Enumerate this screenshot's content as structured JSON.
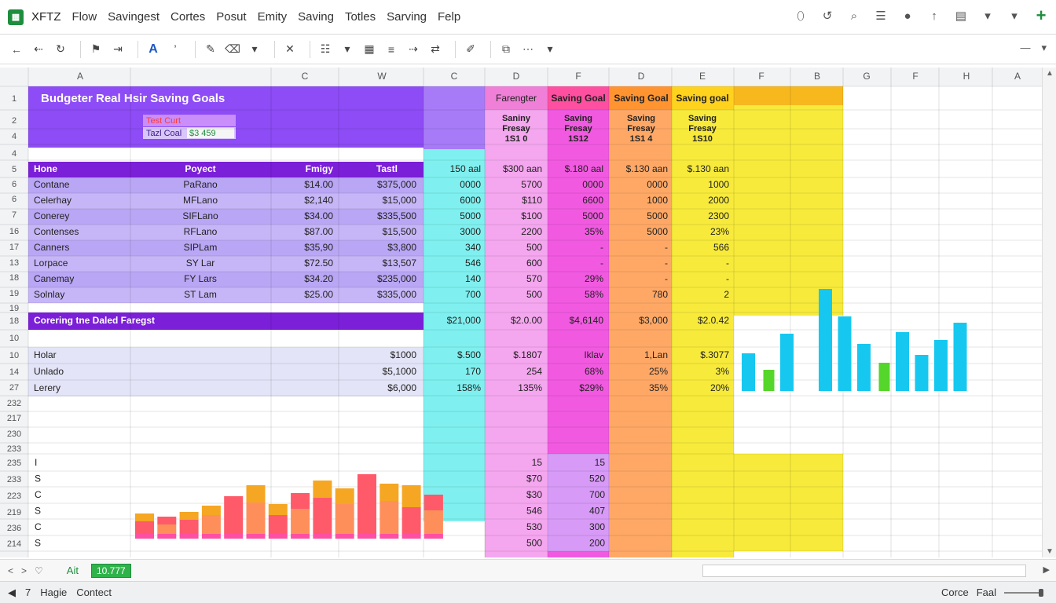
{
  "app": {
    "logo_glyph": "▦",
    "title": "XFTZ"
  },
  "menu": [
    "Flow",
    "Savingest",
    "Cortes",
    "Posut",
    "Emity",
    "Saving",
    "Totles",
    "Sarving",
    "Felp"
  ],
  "top_icons": [
    "lock-icon",
    "history-icon",
    "search-icon",
    "list-icon",
    "user-icon",
    "upload-icon",
    "calendar-icon",
    "chevron-down-icon",
    "chevron-down-icon",
    "add-icon"
  ],
  "toolbar": {
    "undo": "←",
    "redo": "⇠",
    "refresh": "↻",
    "font_btn": "A",
    "font_drop": "ʼ",
    "close": "✕"
  },
  "column_headers": [
    "A",
    "C",
    "W",
    "C",
    "D",
    "F",
    "D",
    "E",
    "F",
    "B",
    "G",
    "F",
    "H",
    "A"
  ],
  "row_headers": [
    "1",
    "2",
    "4",
    "4",
    "5",
    "6",
    "6",
    "7",
    "16",
    "17",
    "13",
    "18",
    "19",
    "19",
    "18",
    "10",
    "10",
    "14",
    "27",
    "232",
    "217",
    "230",
    "233",
    "235",
    "233",
    "223",
    "219",
    "236",
    "214"
  ],
  "sheet": {
    "title": "Budgeter Real Hsir Saving Goals",
    "mini_label_1": "Test Curt",
    "mini_label_2": "Tazl Coal",
    "mini_value": "$3 459",
    "header_cols": [
      "Farengter",
      "Saving Goal",
      "Saving Goal",
      "Saving goal"
    ],
    "sub_headers": [
      [
        "Saniny",
        "Fresay",
        "1S1 0"
      ],
      [
        "Saving",
        "Fresay",
        "1S12"
      ],
      [
        "Saving",
        "Fresay",
        "1S1 4"
      ],
      [
        "Saving",
        "Fresay",
        "1S10"
      ]
    ],
    "table_header": [
      "Hone",
      "Poyect",
      "Fmigy",
      "Tastl",
      "150 aal",
      "$300 aan",
      "$.180 aal",
      "$.130 aan",
      "$.130 aan"
    ],
    "rows": [
      [
        "Contane",
        "PaRano",
        "$14.00",
        "$375,000",
        "0000",
        "5700",
        "0000",
        "0000",
        "1000"
      ],
      [
        "Celerhay",
        "MFLano",
        "$2,140",
        "$15,000",
        "6000",
        "$110",
        "6600",
        "1000",
        "2000"
      ],
      [
        "Conerey",
        "SIFLano",
        "$34.00",
        "$335,500",
        "5000",
        "$100",
        "5000",
        "5000",
        "2300"
      ],
      [
        "Contenses",
        "RFLano",
        "$87.00",
        "$15,500",
        "3000",
        "2200",
        "35%",
        "5000",
        "23%"
      ],
      [
        "Canners",
        "SIPLam",
        "$35,90",
        "$3,800",
        "340",
        "500",
        "-",
        "-",
        "566"
      ],
      [
        "Lorpace",
        "SY Lar",
        "$72.50",
        "$13,507",
        "546",
        "600",
        "-",
        "-",
        "-"
      ],
      [
        "Canemay",
        "FY Lars",
        "$34.20",
        "$235,000",
        "140",
        "570",
        "29%",
        "-",
        "-"
      ],
      [
        "Solnlay",
        "ST Lam",
        "$25.00",
        "$335,000",
        "700",
        "500",
        "58%",
        "780",
        "2"
      ]
    ],
    "section_title": "Corering tne Daled Faregst",
    "section_totals": [
      "$21,000",
      "$2.0.00",
      "$4,6140",
      "$3,000",
      "$2.0.42"
    ],
    "rows2": [
      [
        "Holar",
        "$1000",
        "$.500",
        "$.1807",
        "Iklav",
        "1,Lan",
        "$.3077"
      ],
      [
        "Unlado",
        "$5,1000",
        "170",
        "254",
        "68%",
        "25%",
        "3%"
      ],
      [
        "Lerery",
        "$6,000",
        "158%",
        "135%",
        "$29%",
        "35%",
        "20%"
      ]
    ],
    "lower_labels": [
      "I",
      "S",
      "C",
      "S",
      "C",
      "S"
    ],
    "lower_pink": [
      "15",
      "$70",
      "$30",
      "546",
      "530",
      "500"
    ],
    "lower_purple": [
      "15",
      "520",
      "700",
      "407",
      "300",
      "200"
    ]
  },
  "chart_right": {
    "type": "bar",
    "series": [
      {
        "values": [
          48,
          0,
          73,
          0,
          130,
          95,
          60,
          0,
          75,
          46,
          65,
          87
        ]
      },
      {
        "values": [
          0,
          27,
          0,
          0,
          0,
          0,
          0,
          36,
          0,
          0,
          0,
          0
        ]
      }
    ],
    "colors": [
      "#16c8f0",
      "#55d62a"
    ]
  },
  "chart_bottom": {
    "type": "bar",
    "values_top": [
      32,
      28,
      34,
      42,
      54,
      68,
      44,
      58,
      74,
      64,
      82,
      70,
      68,
      56
    ],
    "values_bottom": [
      22,
      18,
      24,
      30,
      34,
      46,
      30,
      38,
      52,
      44,
      56,
      48,
      40,
      36
    ],
    "colors": [
      "#f5a623",
      "#ff5a6a",
      "#ff4fa3"
    ]
  },
  "tabs": {
    "nav_prev": "<",
    "nav_next": ">",
    "nav_add": "♡",
    "sheet_1": "Ait",
    "sheet_2": "10.777"
  },
  "status": {
    "left_arrow": "◀",
    "left_num": "7",
    "left_1": "Hagie",
    "left_2": "Contect",
    "right_label": "Corce",
    "right_value": "Faal"
  },
  "colors": {
    "purple": "#8d4cf5",
    "purple_dark": "#7b1fd8",
    "lavender": "#c9b8f6",
    "cyan": "#7ff0ef",
    "pink": "#f4a6ee",
    "magenta": "#f15ae0",
    "orange": "#ffa866",
    "yellow": "#f7ea3b"
  }
}
